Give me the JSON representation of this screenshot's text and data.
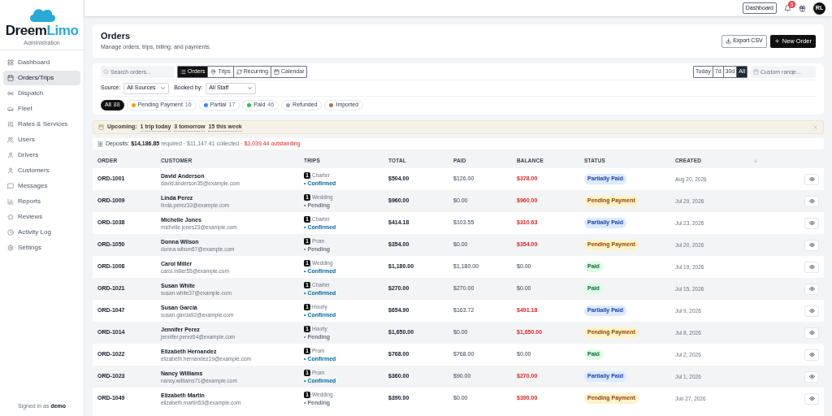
{
  "sidebar": {
    "brand_first": "Dreem",
    "brand_second": "Limo",
    "subtitle": "Administration",
    "items": [
      {
        "label": "Dashboard",
        "selected": false
      },
      {
        "label": "Orders/Trips",
        "selected": true
      },
      {
        "label": "Dispatch",
        "selected": false
      },
      {
        "label": "Fleet",
        "selected": false
      },
      {
        "label": "Rates & Services",
        "selected": false
      },
      {
        "label": "Users",
        "selected": false
      },
      {
        "label": "Drivers",
        "selected": false
      },
      {
        "label": "Customers",
        "selected": false
      },
      {
        "label": "Messages",
        "selected": false
      },
      {
        "label": "Reports",
        "selected": false
      },
      {
        "label": "Reviews",
        "selected": false
      },
      {
        "label": "Activity Log",
        "selected": false
      },
      {
        "label": "Settings",
        "selected": false
      }
    ],
    "footer_prefix": "Signed in as",
    "footer_user": "demo"
  },
  "topbar": {
    "dashboard_button": "Dashboard",
    "notification_count": "5",
    "avatar": "RL"
  },
  "header": {
    "title": "Orders",
    "subtitle": "Manage orders, trips, billing, and payments.",
    "export_button": "Export CSV",
    "new_button": "New Order"
  },
  "filters": {
    "search_placeholder": "Search orders...",
    "views": [
      {
        "label": "Orders",
        "selected": true
      },
      {
        "label": "Trips",
        "selected": false
      },
      {
        "label": "Recurring",
        "selected": false
      },
      {
        "label": "Calendar",
        "selected": false
      }
    ],
    "ranges": [
      {
        "label": "Today",
        "selected": false
      },
      {
        "label": "7d",
        "selected": false
      },
      {
        "label": "30d",
        "selected": false
      },
      {
        "label": "All",
        "selected": true
      }
    ],
    "custom_range_placeholder": "Custom range...",
    "source_label": "Source:",
    "source_value": "All Sources",
    "booked_label": "Booked by:",
    "booked_value": "All Staff",
    "pills": [
      {
        "label": "All",
        "count": "88",
        "selected": true
      },
      {
        "label": "Pending Payment",
        "count": "16",
        "color": "#f59e0b",
        "selected": false
      },
      {
        "label": "Partial",
        "count": "17",
        "color": "#3b82f6",
        "selected": false
      },
      {
        "label": "Paid",
        "count": "46",
        "color": "#22c55e",
        "selected": false
      },
      {
        "label": "Refunded",
        "color": "#94a3b8",
        "selected": false
      },
      {
        "label": "Imported",
        "color": "#a0785a",
        "selected": false
      }
    ]
  },
  "upcoming": {
    "label": "Upcoming:",
    "today": "1 trip today",
    "tomorrow": "3 tomorrow",
    "week": "15 this week"
  },
  "deposits": {
    "label": "Deposits:",
    "required_amount": "$14,186.85",
    "required_text": "required",
    "collected": "· $11,147.41 collected ·",
    "outstanding": "$3,039.44 outstanding"
  },
  "table": {
    "columns": [
      "ORDER",
      "CUSTOMER",
      "TRIPS",
      "TOTAL",
      "PAID",
      "BALANCE",
      "STATUS",
      "CREATED"
    ],
    "rows": [
      {
        "order": "ORD-1001",
        "name": "David Anderson",
        "email": "david.anderson35@example.com",
        "trip_count": "1",
        "trip_type": "Charter",
        "trip_status": "• Confirmed",
        "trip_confirmed": true,
        "total": "$504.00",
        "paid": "$126.00",
        "balance": "$378.00",
        "balance_due": true,
        "status": "Partially Paid",
        "kind": "partial",
        "created": "Aug 20, 2026"
      },
      {
        "order": "ORD-1009",
        "name": "Linda Perez",
        "email": "linda.perez32@example.com",
        "trip_count": "1",
        "trip_type": "Wedding",
        "trip_status": "• Pending",
        "trip_confirmed": false,
        "total": "$960.00",
        "paid": "$0.00",
        "balance": "$960.00",
        "balance_due": true,
        "status": "Pending Payment",
        "kind": "pending",
        "created": "Jul 29, 2026"
      },
      {
        "order": "ORD-1038",
        "name": "Michelle Jones",
        "email": "michelle.jones23@example.com",
        "trip_count": "1",
        "trip_type": "Charter",
        "trip_status": "• Confirmed",
        "trip_confirmed": true,
        "total": "$414.18",
        "paid": "$103.55",
        "balance": "$310.63",
        "balance_due": true,
        "status": "Partially Paid",
        "kind": "partial",
        "created": "Jul 23, 2026"
      },
      {
        "order": "ORD-1050",
        "name": "Donna Wilson",
        "email": "donna.wilson67@example.com",
        "trip_count": "1",
        "trip_type": "Prom",
        "trip_status": "• Pending",
        "trip_confirmed": false,
        "total": "$354.00",
        "paid": "$0.00",
        "balance": "$354.00",
        "balance_due": true,
        "status": "Pending Payment",
        "kind": "pending",
        "created": "Jul 20, 2026"
      },
      {
        "order": "ORD-1008",
        "name": "Carol Miller",
        "email": "carol.miller55@example.com",
        "trip_count": "1",
        "trip_type": "Wedding",
        "trip_status": "• Confirmed",
        "trip_confirmed": true,
        "total": "$1,180.00",
        "paid": "$1,180.00",
        "balance": "$0.00",
        "balance_due": false,
        "status": "Paid",
        "kind": "paid",
        "created": "Jul 19, 2026"
      },
      {
        "order": "ORD-1021",
        "name": "Susan White",
        "email": "susan.white37@example.com",
        "trip_count": "1",
        "trip_type": "Charter",
        "trip_status": "• Confirmed",
        "trip_confirmed": true,
        "total": "$270.00",
        "paid": "$270.00",
        "balance": "$0.00",
        "balance_due": false,
        "status": "Paid",
        "kind": "paid",
        "created": "Jul 15, 2026"
      },
      {
        "order": "ORD-1047",
        "name": "Susan Garcia",
        "email": "susan.garcia92@example.com",
        "trip_count": "1",
        "trip_type": "Hourly",
        "trip_status": "• Confirmed",
        "trip_confirmed": true,
        "total": "$654.90",
        "paid": "$163.72",
        "balance": "$491.18",
        "balance_due": true,
        "status": "Partially Paid",
        "kind": "partial",
        "created": "Jul 9, 2026"
      },
      {
        "order": "ORD-1014",
        "name": "Jennifer Perez",
        "email": "jennifer.perez64@example.com",
        "trip_count": "1",
        "trip_type": "Hourly",
        "trip_status": "• Pending",
        "trip_confirmed": false,
        "total": "$1,650.00",
        "paid": "$0.00",
        "balance": "$1,650.00",
        "balance_due": true,
        "status": "Pending Payment",
        "kind": "pending",
        "created": "Jul 8, 2026"
      },
      {
        "order": "ORD-1022",
        "name": "Elizabeth Hernandez",
        "email": "elizabeth.hernandez19@example.com",
        "trip_count": "1",
        "trip_type": "Prom",
        "trip_status": "• Confirmed",
        "trip_confirmed": true,
        "total": "$768.00",
        "paid": "$768.00",
        "balance": "$0.00",
        "balance_due": false,
        "status": "Paid",
        "kind": "paid",
        "created": "Jul 2, 2026"
      },
      {
        "order": "ORD-1023",
        "name": "Nancy Williams",
        "email": "nancy.williams71@example.com",
        "trip_count": "1",
        "trip_type": "Prom",
        "trip_status": "• Confirmed",
        "trip_confirmed": true,
        "total": "$360.00",
        "paid": "$90.00",
        "balance": "$270.00",
        "balance_due": true,
        "status": "Partially Paid",
        "kind": "partial",
        "created": "Jul 1, 2026"
      },
      {
        "order": "ORD-1049",
        "name": "Elizabeth Martin",
        "email": "elizabeth.martin53@example.com",
        "trip_count": "1",
        "trip_type": "Wedding",
        "trip_status": "• Pending",
        "trip_confirmed": false,
        "total": "$390.00",
        "paid": "$0.00",
        "balance": "$390.00",
        "balance_due": true,
        "status": "Pending Payment",
        "kind": "pending",
        "created": "Jun 27, 2026"
      }
    ]
  }
}
